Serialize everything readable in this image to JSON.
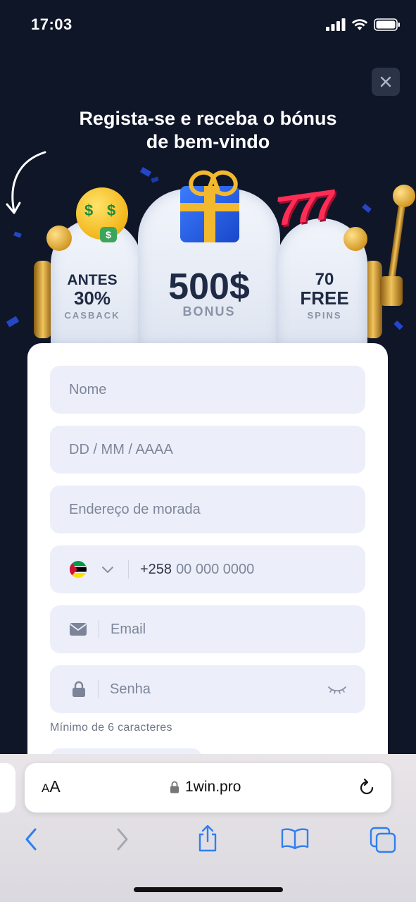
{
  "status_bar": {
    "time": "17:03"
  },
  "hero": {
    "title_line1": "Regista-se e receba o bónus",
    "title_line2": "de bem-vindo"
  },
  "slot": {
    "left_big1": "ANTES",
    "left_big2": "30%",
    "left_sub": "CASBACK",
    "center_big": "500$",
    "center_sub": "BONUS",
    "right_big1": "70",
    "right_big2": "FREE",
    "right_sub": "SPINS",
    "sevens": "777"
  },
  "form": {
    "name_placeholder": "Nome",
    "date_placeholder": "DD / MM / AAAA",
    "address_placeholder": "Endereço de morada",
    "phone_code": "+258",
    "phone_placeholder": "00 000 0000",
    "email_placeholder": "Email",
    "password_placeholder": "Senha",
    "password_hint": "Mínimo de 6 caracteres"
  },
  "browser": {
    "text_size_label": "AA",
    "url": "1win.pro"
  },
  "colors": {
    "background": "#0f1628",
    "field_bg": "#eceff9",
    "safari_icon": "#2f7ff0"
  }
}
